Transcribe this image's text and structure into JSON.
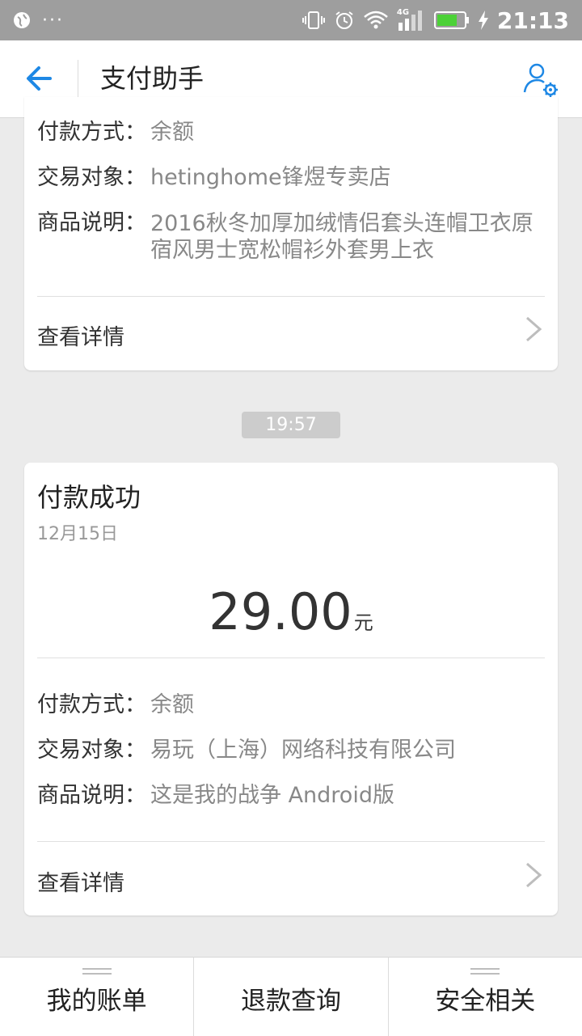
{
  "status_bar": {
    "time": "21:13",
    "left_dots": "···",
    "net_label": "4G"
  },
  "header": {
    "title": "支付助手"
  },
  "card1": {
    "rows": [
      {
        "label": "付款方式：",
        "value": "余额"
      },
      {
        "label": "交易对象：",
        "value": "hetinghome锋煜专卖店"
      },
      {
        "label": "商品说明：",
        "value": "2016秋冬加厚加绒情侣套头连帽卫衣原宿风男士宽松帽衫外套男上衣"
      }
    ],
    "details_label": "查看详情"
  },
  "time_badge": "19:57",
  "card2": {
    "title": "付款成功",
    "date": "12月15日",
    "amount": "29.00",
    "unit": "元",
    "rows": [
      {
        "label": "付款方式：",
        "value": "余额"
      },
      {
        "label": "交易对象：",
        "value": "易玩（上海）网络科技有限公司"
      },
      {
        "label": "商品说明：",
        "value": "这是我的战争 Android版"
      }
    ],
    "details_label": "查看详情"
  },
  "bottom_nav": [
    {
      "label": "我的账单"
    },
    {
      "label": "退款查询"
    },
    {
      "label": "安全相关"
    }
  ],
  "colors": {
    "accent": "#1e88e5",
    "status_bar": "#9e9e9e",
    "background": "#ebebeb"
  },
  "icons": [
    "back-arrow-icon",
    "user-settings-icon",
    "chevron-right-icon",
    "wifi-icon",
    "battery-icon",
    "alarm-icon",
    "vibrate-icon"
  ]
}
